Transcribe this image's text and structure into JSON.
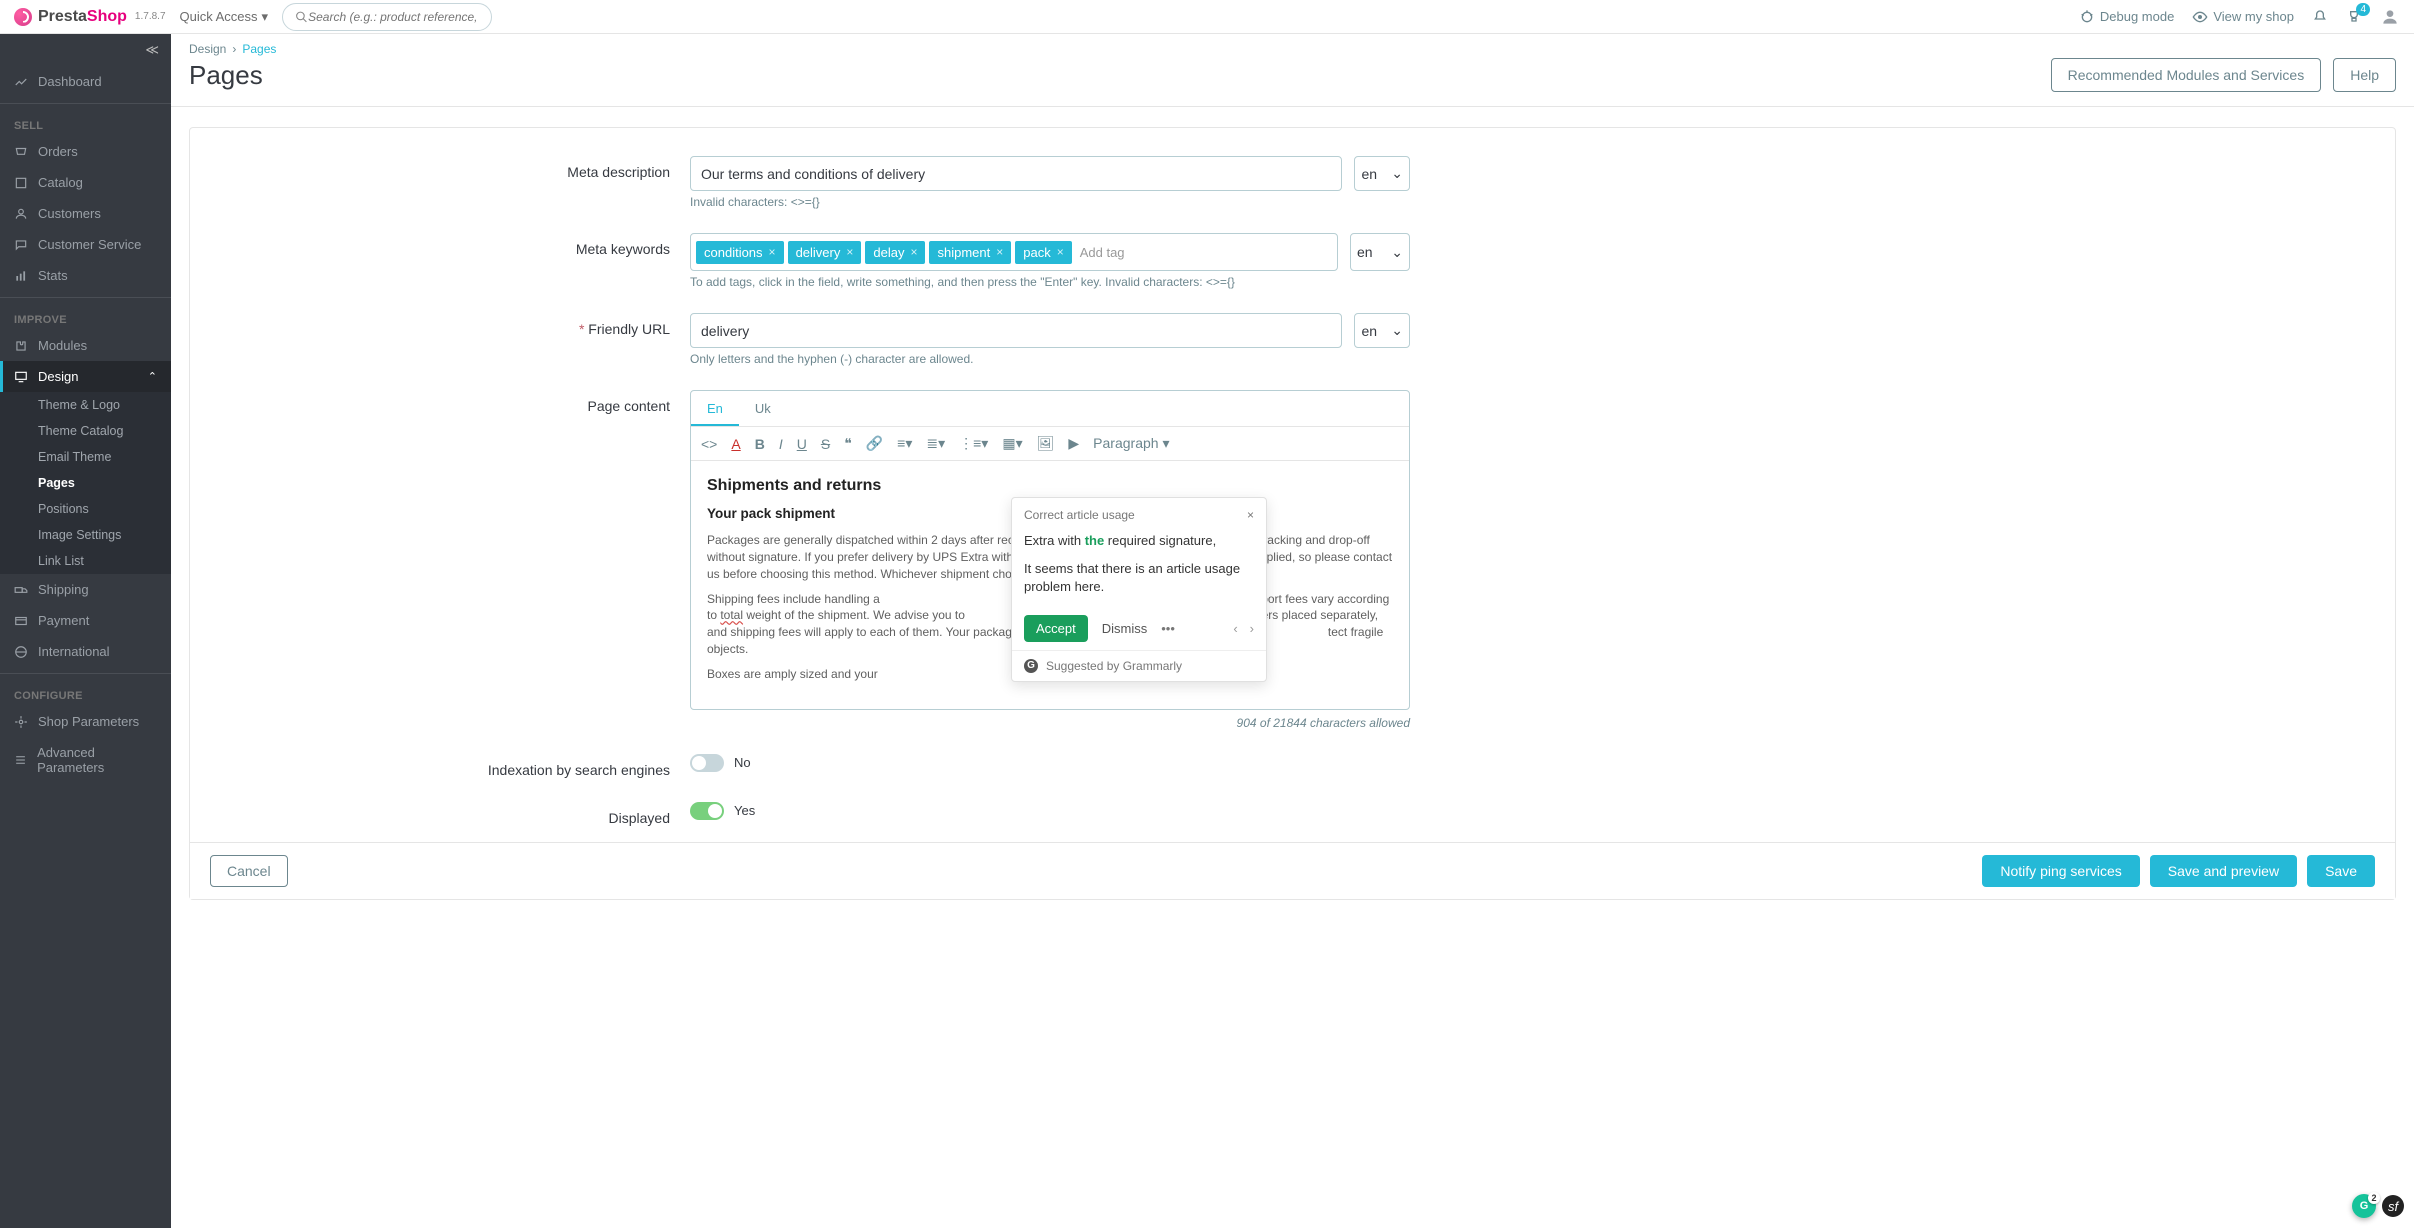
{
  "logo": {
    "left": "Presta",
    "right": "Shop",
    "version": "1.7.8.7"
  },
  "topbar": {
    "quick_access": "Quick Access",
    "search_placeholder": "Search (e.g.: product reference, custom",
    "debug": "Debug mode",
    "view_shop": "View my shop",
    "notif_count": "4"
  },
  "sidebar": {
    "dashboard": "Dashboard",
    "sect_sell": "SELL",
    "orders": "Orders",
    "catalog": "Catalog",
    "customers": "Customers",
    "cust_service": "Customer Service",
    "stats": "Stats",
    "sect_improve": "IMPROVE",
    "modules": "Modules",
    "design": "Design",
    "design_sub": {
      "theme_logo": "Theme & Logo",
      "theme_catalog": "Theme Catalog",
      "email_theme": "Email Theme",
      "pages": "Pages",
      "positions": "Positions",
      "image_settings": "Image Settings",
      "link_list": "Link List"
    },
    "shipping": "Shipping",
    "payment": "Payment",
    "international": "International",
    "sect_conf": "CONFIGURE",
    "shop_params": "Shop Parameters",
    "adv_params": "Advanced Parameters"
  },
  "breadcrumb": {
    "root": "Design",
    "current": "Pages"
  },
  "page_title": "Pages",
  "header_actions": {
    "recommended": "Recommended Modules and Services",
    "help": "Help"
  },
  "fields": {
    "meta_desc": {
      "label": "Meta description",
      "value": "Our terms and conditions of delivery",
      "help": "Invalid characters: <>={}",
      "lang": "en"
    },
    "meta_keywords": {
      "label": "Meta keywords",
      "tags": [
        "conditions",
        "delivery",
        "delay",
        "shipment",
        "pack"
      ],
      "add": "Add tag",
      "help": "To add tags, click in the field, write something, and then press the \"Enter\" key. Invalid characters: <>={}",
      "lang": "en"
    },
    "friendly_url": {
      "label": "Friendly URL",
      "value": "delivery",
      "help": "Only letters and the hyphen (-) character are allowed.",
      "lang": "en"
    },
    "page_content": {
      "label": "Page content",
      "tabs": {
        "en": "En",
        "uk": "Uk"
      },
      "paragraph_btn": "Paragraph",
      "h1": "Shipments and returns",
      "h2": "Your pack shipment",
      "p1a": "Packages are generally dispatched within 2 days after receipt of payment and are shipped via UPS with tracking and drop-off without signature. If you prefer delivery by UPS Extra with ",
      "p1b": "required",
      "p1c": " signature, an additional cost will be applied, so please contact us before choosing this method. Whichever shipment choice you make, we w",
      "p2a": "Shipping fees include handling a",
      "p2b": "re fixed, whereas transport fees vary according to ",
      "p2c": "total",
      "p2d": " weight of the shipment. We advise you to",
      "p2e": "nct orders placed separately, and shipping fees will apply to each of them. Your package will be di",
      "p2f": "tect fragile objects.",
      "p3": "Boxes are amply sized and your",
      "counter": "904 of 21844 characters allowed"
    },
    "indexation": {
      "label": "Indexation by search engines",
      "value": "No"
    },
    "displayed": {
      "label": "Displayed",
      "value": "Yes"
    }
  },
  "footer": {
    "cancel": "Cancel",
    "notify": "Notify ping services",
    "save_preview": "Save and preview",
    "save": "Save"
  },
  "grammarly": {
    "title": "Correct article usage",
    "line_a": "Extra with ",
    "line_grn": "the",
    "line_b": " required signature,",
    "explain": "It seems that there is an article usage problem here.",
    "accept": "Accept",
    "dismiss": "Dismiss",
    "foot": "Suggested by Grammarly",
    "badge_n": "2"
  }
}
